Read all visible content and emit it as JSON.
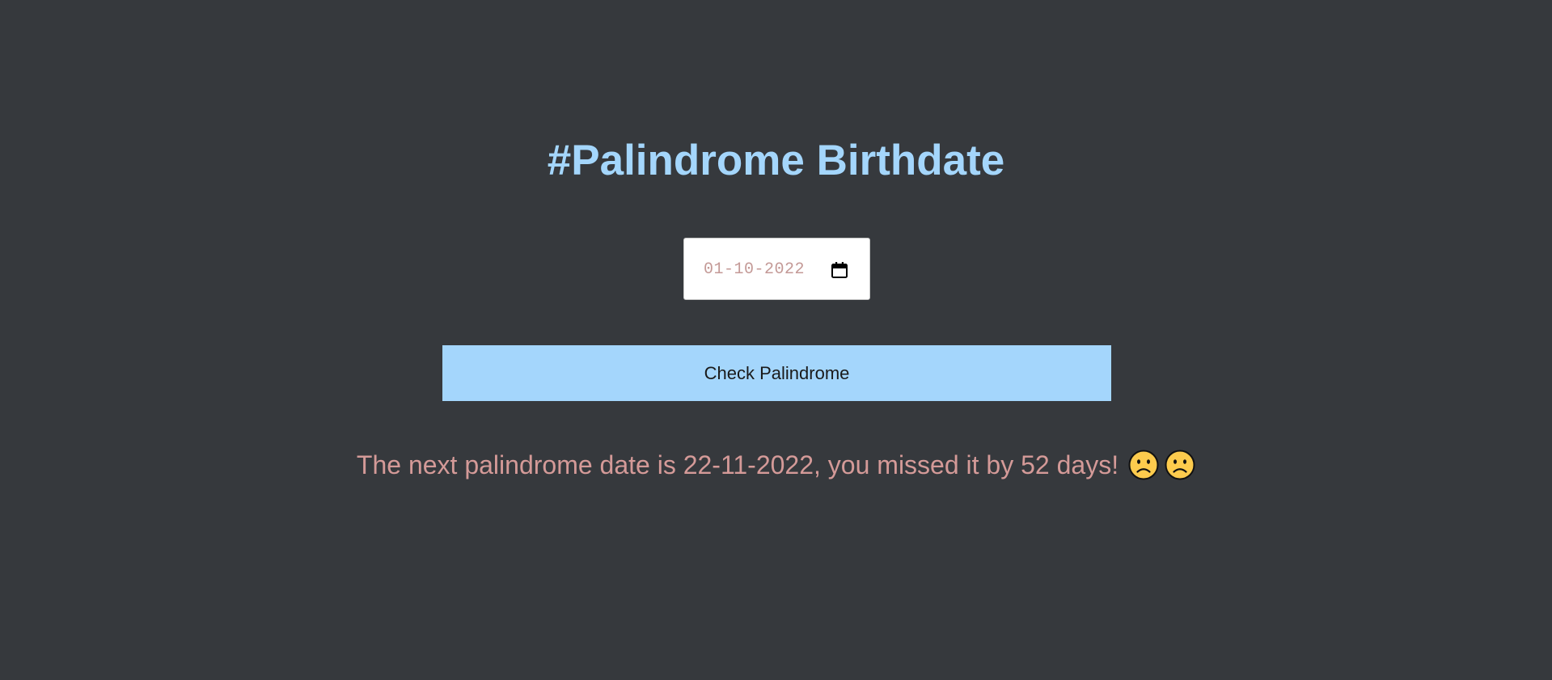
{
  "header": {
    "title": "#Palindrome Birthdate"
  },
  "date_input": {
    "value": "01-10-2022",
    "icon": "calendar-icon"
  },
  "check_button": {
    "label": "Check Palindrome"
  },
  "result": {
    "message": "The next palindrome date is 22-11-2022, you missed it by 52 days!",
    "emojis": [
      "slightly-frowning-face",
      "slightly-frowning-face"
    ]
  },
  "colors": {
    "background": "#36393d",
    "accent": "#a4d6fc",
    "result_text": "#d49a98",
    "input_text": "#c49a97"
  }
}
